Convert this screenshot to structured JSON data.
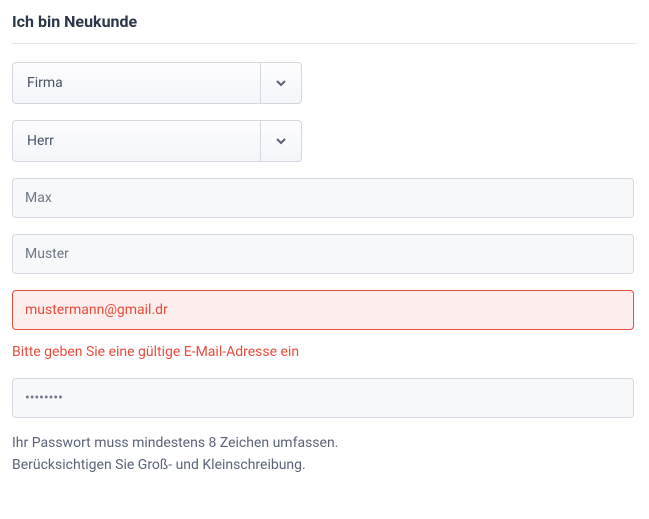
{
  "heading": "Ich bin Neukunde",
  "customerType": {
    "selected": "Firma"
  },
  "salutation": {
    "selected": "Herr"
  },
  "firstName": {
    "value": "Max"
  },
  "lastName": {
    "value": "Muster"
  },
  "email": {
    "value": "mustermann@gmail.dr",
    "error": "Bitte geben Sie eine gültige E-Mail-Adresse ein"
  },
  "password": {
    "value": "••••••••",
    "hint1": "Ihr Passwort muss mindestens 8 Zeichen umfassen.",
    "hint2": "Berücksichtigen Sie Groß- und Kleinschreibung."
  }
}
